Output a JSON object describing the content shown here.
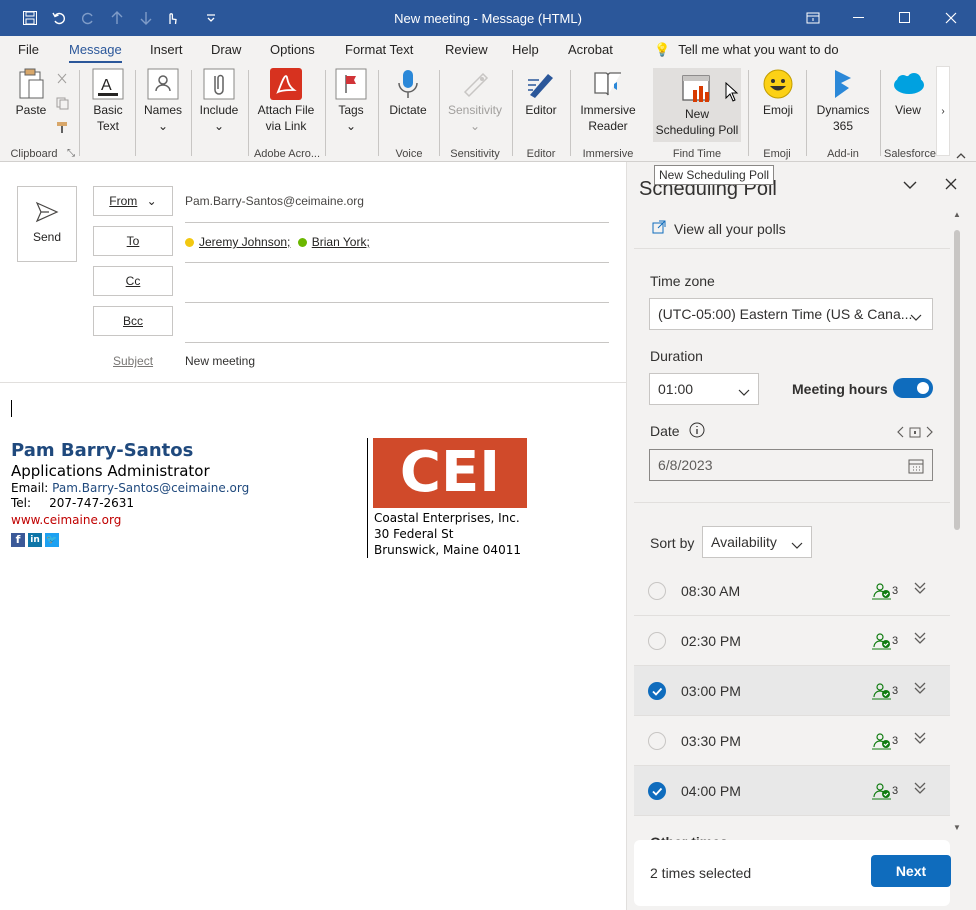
{
  "window": {
    "title": "New meeting  -  Message (HTML)"
  },
  "tabs": [
    "File",
    "Message",
    "Insert",
    "Draw",
    "Options",
    "Format Text",
    "Review",
    "Help",
    "Acrobat"
  ],
  "tell_me": "Tell me what you want to do",
  "ribbon": {
    "paste": "Paste",
    "basic_text": "Basic Text",
    "names": "Names",
    "include": "Include",
    "attach_file": "Attach File via Link",
    "tags": "Tags",
    "dictate": "Dictate",
    "sensitivity": "Sensitivity",
    "editor": "Editor",
    "immersive": "Immersive Reader",
    "new_poll": "New Scheduling Poll",
    "emoji": "Emoji",
    "dynamics": "Dynamics 365",
    "view": "View",
    "groups": [
      "Clipboard",
      "Adobe Acro...",
      "Voice",
      "Sensitivity",
      "Editor",
      "Immersive",
      "Find Time",
      "Emoji",
      "Add-in",
      "Salesforce"
    ]
  },
  "tooltip": "New Scheduling Poll",
  "compose": {
    "send": "Send",
    "from_label": "From",
    "from_value": "Pam.Barry-Santos@ceimaine.org",
    "to_label": "To",
    "recipients": [
      {
        "name": "Jeremy Johnson;",
        "status_color": "#f2c811"
      },
      {
        "name": "Brian York;",
        "status_color": "#6bb700"
      }
    ],
    "cc_label": "Cc",
    "bcc_label": "Bcc",
    "subject_label": "Subject",
    "subject_value": "New meeting"
  },
  "signature": {
    "name": "Pam Barry-Santos",
    "title": "Applications Administrator",
    "email_label": "Email:",
    "email": "Pam.Barry-Santos@ceimaine.org",
    "tel_label": "Tel:",
    "tel": "207-747-2631",
    "website": "www.ceimaine.org",
    "logo_text": "CEI",
    "company": "Coastal Enterprises, Inc.",
    "address1": "30 Federal St",
    "address2": "Brunswick, Maine 04011"
  },
  "pane": {
    "title": "Scheduling Poll",
    "view_polls": "View all your polls",
    "timezone_label": "Time zone",
    "timezone_value": "(UTC-05:00) Eastern Time (US & Cana...",
    "duration_label": "Duration",
    "duration_value": "01:00",
    "meeting_hours_label": "Meeting hours",
    "date_label": "Date",
    "date_value": "6/8/2023",
    "sort_label": "Sort by",
    "sort_value": "Availability",
    "slots": [
      {
        "time": "08:30 AM",
        "count": "3",
        "selected": false
      },
      {
        "time": "02:30 PM",
        "count": "3",
        "selected": false
      },
      {
        "time": "03:00 PM",
        "count": "3",
        "selected": true
      },
      {
        "time": "03:30 PM",
        "count": "3",
        "selected": false
      },
      {
        "time": "04:00 PM",
        "count": "3",
        "selected": true
      }
    ],
    "other_label": "Other times",
    "selected_text": "2 times selected",
    "next": "Next"
  },
  "colors": {
    "accent": "#2b579a",
    "brand_blue": "#0f6cbd",
    "cei_red": "#d04a2a"
  }
}
